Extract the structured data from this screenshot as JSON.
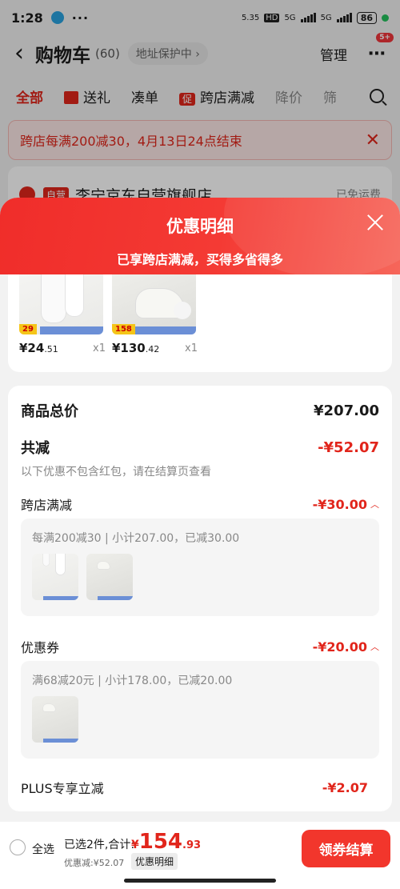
{
  "status_bar": {
    "time": "1:28",
    "dots": "···",
    "net_speed": "5.35\nKB/s",
    "hd": "HD",
    "net1": "5G",
    "net2": "5G",
    "battery": "86"
  },
  "nav": {
    "title": "购物车",
    "count": "(60)",
    "address_chip": "地址保护中",
    "manage": "管理",
    "more_badge": "5+"
  },
  "filter_tabs": [
    {
      "label": "全部",
      "active": true
    },
    {
      "label": "送礼"
    },
    {
      "label": "凑单"
    },
    {
      "label": "跨店满减",
      "tag": "促"
    },
    {
      "label": "降价",
      "muted": true
    },
    {
      "label": "筛",
      "muted": true
    }
  ],
  "promo_banner": {
    "text": "跨店每满200减30，4月13日24点结束"
  },
  "shop": {
    "self_tag": "自营",
    "name": "李宁京东自营旗舰店",
    "free_ship": "已免运费"
  },
  "sheet": {
    "title": "优惠明细",
    "subtitle": "已享跨店满减，买得多省得多",
    "products": [
      {
        "price_tag": "29",
        "price_int": "¥24",
        "price_dec": ".51",
        "qty": "x1"
      },
      {
        "price_tag": "158",
        "price_int": "¥130",
        "price_dec": ".42",
        "qty": "x1"
      }
    ],
    "goods_total_label": "商品总价",
    "goods_total_value": "¥207.00",
    "reduce_label": "共减",
    "reduce_value": "-¥52.07",
    "reduce_note": "以下优惠不包含红包，请在结算页查看",
    "cross_store_label": "跨店满减",
    "cross_store_value": "-¥30.00",
    "cross_store_detail": "每满200减30 | 小计207.00，已减30.00",
    "coupon_label": "优惠券",
    "coupon_value": "-¥20.00",
    "coupon_detail": "满68减20元 | 小计178.00，已减20.00",
    "plus_label": "PLUS专享立减",
    "plus_value": "-¥2.07"
  },
  "bottom_bar": {
    "select_all": "全选",
    "selected_text": "已选2件,合计:",
    "total_symbol": "¥",
    "total_int": "154",
    "total_dec": ".93",
    "discount_text": "优惠减:¥52.07",
    "detail_chip": "优惠明细",
    "checkout": "领券结算"
  }
}
